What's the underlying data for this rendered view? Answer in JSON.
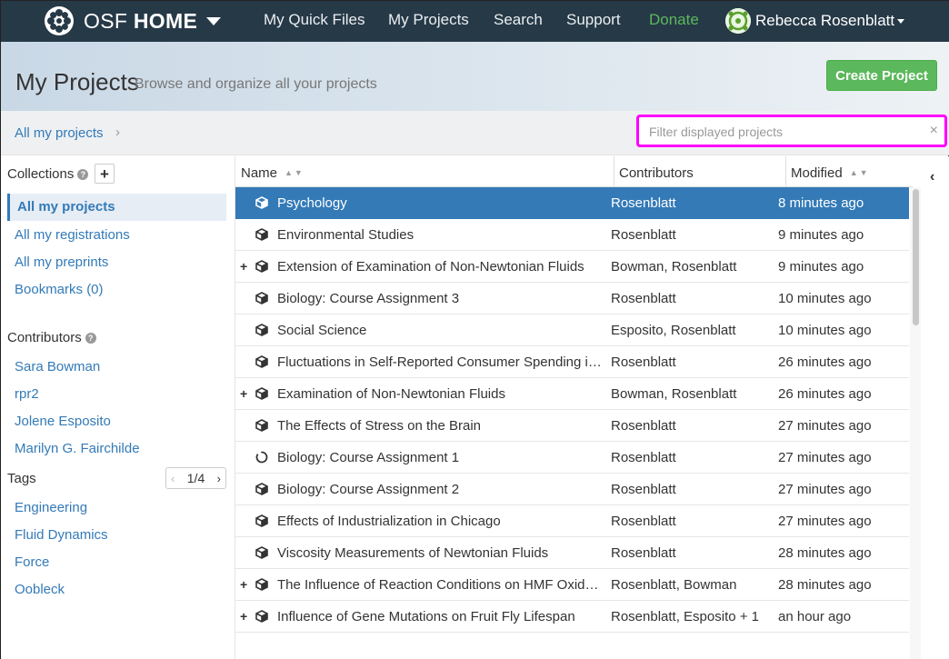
{
  "navbar": {
    "brand_prefix": "OSF",
    "brand_bold": "HOME",
    "links": [
      "My Quick Files",
      "My Projects",
      "Search",
      "Support"
    ],
    "donate": "Donate",
    "user_name": "Rebecca Rosenblatt",
    "bg_color": "#263947",
    "donate_color": "#5cb85c"
  },
  "header": {
    "title": "My Projects",
    "subtitle": "Browse and organize all your projects",
    "create_button": "Create Project"
  },
  "breadcrumb": {
    "current": "All my projects"
  },
  "filter": {
    "placeholder": "Filter displayed projects",
    "value": "",
    "clear_icon": "×",
    "highlight_color": "#ff00ff"
  },
  "sidebar": {
    "collections_heading": "Collections",
    "add_label": "+",
    "collections": [
      "All my projects",
      "All my registrations",
      "All my preprints",
      "Bookmarks (0)"
    ],
    "active_collection": "All my projects",
    "contributors_heading": "Contributors",
    "contributors": [
      "Sara Bowman",
      "rpr2",
      "Jolene Esposito",
      "Marilyn G. Fairchilde"
    ],
    "tags_heading": "Tags",
    "tags_pager": "1/4",
    "tags": [
      "Engineering",
      "Fluid Dynamics",
      "Force",
      "Oobleck"
    ]
  },
  "table": {
    "columns": [
      "Name",
      "Contributors",
      "Modified"
    ],
    "rows": [
      {
        "expand": "",
        "icon": "project-icon",
        "name": "Psychology",
        "contributors": "Rosenblatt",
        "modified": "8 minutes ago",
        "selected": true
      },
      {
        "expand": "",
        "icon": "project-icon",
        "name": "Environmental Studies",
        "contributors": "Rosenblatt",
        "modified": "9 minutes ago",
        "selected": false
      },
      {
        "expand": "+",
        "icon": "project-icon",
        "name": "Extension of Examination of Non-Newtonian Fluids",
        "contributors": "Bowman, Rosenblatt",
        "modified": "9 minutes ago",
        "selected": false
      },
      {
        "expand": "",
        "icon": "project-icon",
        "name": "Biology: Course Assignment 3",
        "contributors": "Rosenblatt",
        "modified": "10 minutes ago",
        "selected": false
      },
      {
        "expand": "",
        "icon": "project-icon",
        "name": "Social Science",
        "contributors": "Esposito, Rosenblatt",
        "modified": "10 minutes ago",
        "selected": false
      },
      {
        "expand": "",
        "icon": "project-icon",
        "name": "Fluctuations in Self-Reported Consumer Spending in …",
        "contributors": "Rosenblatt",
        "modified": "26 minutes ago",
        "selected": false
      },
      {
        "expand": "+",
        "icon": "project-icon",
        "name": "Examination of Non-Newtonian Fluids",
        "contributors": "Bowman, Rosenblatt",
        "modified": "26 minutes ago",
        "selected": false
      },
      {
        "expand": "",
        "icon": "project-icon",
        "name": "The Effects of Stress on the Brain",
        "contributors": "Rosenblatt",
        "modified": "27 minutes ago",
        "selected": false
      },
      {
        "expand": "",
        "icon": "loading-icon",
        "name": "Biology: Course Assignment 1",
        "contributors": "Rosenblatt",
        "modified": "27 minutes ago",
        "selected": false
      },
      {
        "expand": "",
        "icon": "project-icon",
        "name": "Biology: Course Assignment 2",
        "contributors": "Rosenblatt",
        "modified": "27 minutes ago",
        "selected": false
      },
      {
        "expand": "",
        "icon": "project-icon",
        "name": "Effects of Industrialization in Chicago",
        "contributors": "Rosenblatt",
        "modified": "27 minutes ago",
        "selected": false
      },
      {
        "expand": "",
        "icon": "project-icon",
        "name": "Viscosity Measurements of Newtonian Fluids",
        "contributors": "Rosenblatt",
        "modified": "28 minutes ago",
        "selected": false
      },
      {
        "expand": "+",
        "icon": "project-icon",
        "name": "The Influence of Reaction Conditions on HMF Oxidati…",
        "contributors": "Rosenblatt, Bowman",
        "modified": "28 minutes ago",
        "selected": false
      },
      {
        "expand": "+",
        "icon": "project-icon",
        "name": "Influence of Gene Mutations on Fruit Fly Lifespan",
        "contributors": "Rosenblatt, Esposito + 1",
        "modified": "an hour ago",
        "selected": false
      }
    ],
    "selected_color": "#337ab7"
  }
}
